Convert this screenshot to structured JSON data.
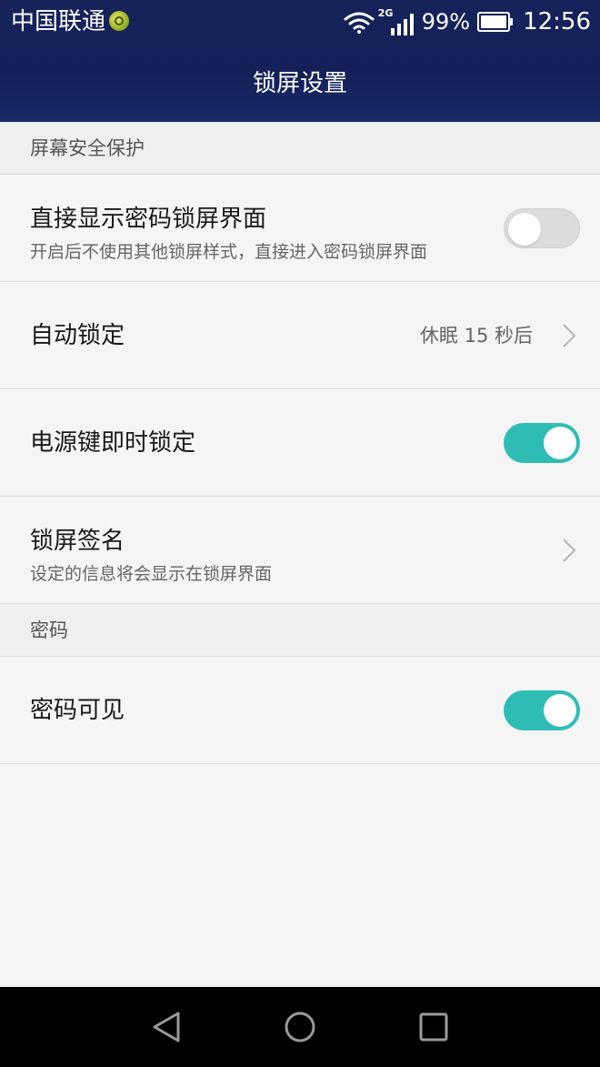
{
  "status_bar": {
    "carrier": "中国联通",
    "network_type": "2G",
    "battery_percent": "99%",
    "time": "12:56",
    "icons": [
      "carrier-badge-icon",
      "wifi-icon",
      "signal-icon",
      "battery-icon"
    ]
  },
  "header": {
    "title": "锁屏设置"
  },
  "sections": [
    {
      "header": "屏幕安全保护",
      "rows": [
        {
          "title": "直接显示密码锁屏界面",
          "subtitle": "开启后不使用其他锁屏样式，直接进入密码锁屏界面",
          "control": "toggle",
          "toggle_state": "off"
        },
        {
          "title": "自动锁定",
          "value": "休眠 15 秒后",
          "control": "chevron"
        },
        {
          "title": "电源键即时锁定",
          "control": "toggle",
          "toggle_state": "on"
        },
        {
          "title": "锁屏签名",
          "subtitle": "设定的信息将会显示在锁屏界面",
          "control": "chevron"
        }
      ]
    },
    {
      "header": "密码",
      "rows": [
        {
          "title": "密码可见",
          "control": "toggle",
          "toggle_state": "on"
        }
      ]
    }
  ],
  "colors": {
    "header_bg": "#17225a",
    "toggle_on": "#2ebdb5",
    "toggle_off": "#dcdcdc",
    "page_bg": "#f5f5f5",
    "section_bg": "#efefef"
  },
  "nav_bar": {
    "icons": [
      "back-icon",
      "home-icon",
      "recent-apps-icon"
    ]
  }
}
